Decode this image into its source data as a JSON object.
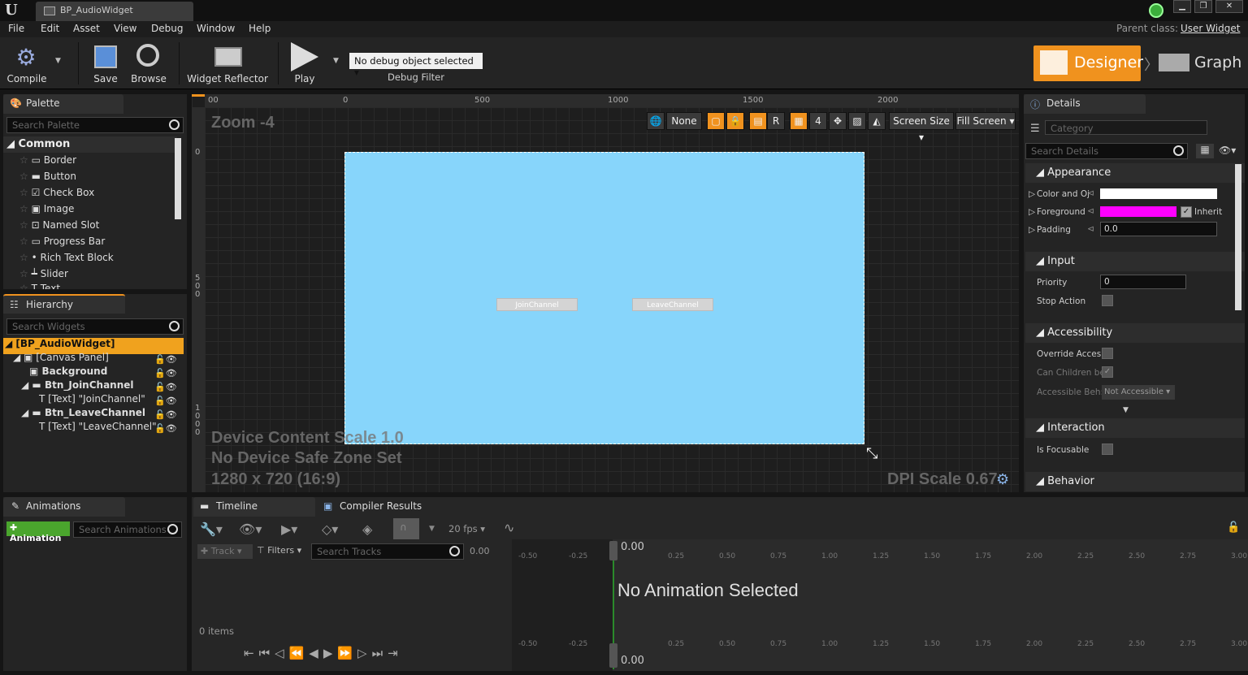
{
  "titlebar": {
    "tab_title": "BP_AudioWidget",
    "parent_class_label": "Parent class:",
    "parent_class_value": "User Widget",
    "logo": "U"
  },
  "menu": [
    "File",
    "Edit",
    "Asset",
    "View",
    "Debug",
    "Window",
    "Help"
  ],
  "toolbar": {
    "compile": "Compile",
    "save": "Save",
    "browse": "Browse",
    "widget_reflector": "Widget Reflector",
    "play": "Play",
    "debug_select": "No debug object selected",
    "debug_filter": "Debug Filter",
    "designer": "Designer",
    "graph": "Graph"
  },
  "palette": {
    "tab": "Palette",
    "search_placeholder": "Search Palette",
    "category": "Common",
    "items": [
      "Border",
      "Button",
      "Check Box",
      "Image",
      "Named Slot",
      "Progress Bar",
      "Rich Text Block",
      "Slider",
      "Text"
    ]
  },
  "hierarchy": {
    "tab": "Hierarchy",
    "search_placeholder": "Search Widgets",
    "rows": [
      "[BP_AudioWidget]",
      "[Canvas Panel]",
      "Background",
      "Btn_JoinChannel",
      "[Text] \"JoinChannel\"",
      "Btn_LeaveChannel",
      "[Text] \"LeaveChannel\""
    ]
  },
  "canvas": {
    "zoom": "Zoom -4",
    "ruler_x": [
      "00",
      "0",
      "500",
      "1000",
      "1500",
      "2000"
    ],
    "ruler_y": [
      "0",
      "500",
      "1000"
    ],
    "btn_join": "JoinChannel",
    "btn_leave": "LeaveChannel",
    "device_scale": "Device Content Scale 1.0",
    "safe_zone": "No Device Safe Zone Set",
    "resolution": "1280 x 720 (16:9)",
    "dpi": "DPI Scale 0.67",
    "ctl_none": "None",
    "ctl_r": "R",
    "ctl_4": "4",
    "screen_size": "Screen Size",
    "fill_screen": "Fill Screen"
  },
  "details": {
    "tab": "Details",
    "category_placeholder": "Category",
    "search_placeholder": "Search Details",
    "appearance": "Appearance",
    "color_label": "Color and Oj",
    "foreground_label": "Foreground",
    "inherit": "Inherit",
    "padding_label": "Padding",
    "padding_value": "0.0",
    "input": "Input",
    "priority_label": "Priority",
    "priority_value": "0",
    "stop_action": "Stop Action",
    "accessibility": "Accessibility",
    "override_access": "Override Acces:",
    "can_children": "Can Children be",
    "accessible_beh": "Accessible Beh:",
    "not_accessible": "Not Accessible",
    "interaction": "Interaction",
    "is_focusable": "Is Focusable",
    "behavior": "Behavior",
    "foreground_color": "#ff00ff"
  },
  "animations": {
    "tab": "Animations",
    "add": "Animation",
    "search_placeholder": "Search Animations"
  },
  "timeline": {
    "tab": "Timeline",
    "compiler_tab": "Compiler Results",
    "fps": "20 fps",
    "track": "Track",
    "filters": "Filters",
    "search_placeholder": "Search Tracks",
    "time": "0.00",
    "items": "0 items",
    "no_anim": "No Animation Selected",
    "ticks": [
      "-0.50",
      "-0.25",
      "0.25",
      "0.50",
      "0.75",
      "1.00",
      "1.25",
      "1.50",
      "1.75",
      "2.00",
      "2.25",
      "2.50",
      "2.75",
      "3.00"
    ]
  }
}
